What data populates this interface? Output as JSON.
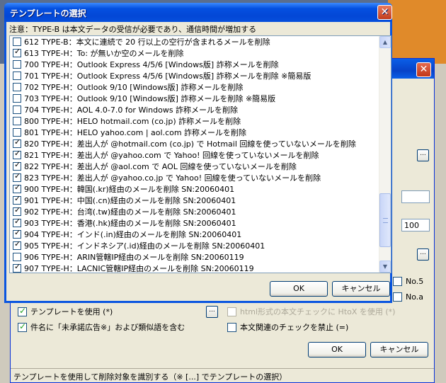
{
  "dialog": {
    "title": "テンプレートの選択",
    "notice": "注意：TYPE-B は本文データの受信が必要であり、通信時間が増加する",
    "ok_label": "OK",
    "cancel_label": "キャンセル",
    "items": [
      {
        "checked": false,
        "label": "612 TYPE-B：本文に連続で 20 行以上の空行が含まれるメールを削除"
      },
      {
        "checked": true,
        "label": "613 TYPE-H：To: が無いか空のメールを削除"
      },
      {
        "checked": false,
        "label": "700 TYPE-H：Outlook Express 4/5/6 [Windows版] 詐称メールを削除"
      },
      {
        "checked": false,
        "label": "701 TYPE-H：Outlook Express 4/5/6 [Windows版] 詐称メールを削除 ※簡易版"
      },
      {
        "checked": false,
        "label": "702 TYPE-H：Outlook 9/10 [Windows版] 詐称メールを削除"
      },
      {
        "checked": false,
        "label": "703 TYPE-H：Outlook 9/10 [Windows版] 詐称メールを削除 ※簡易版"
      },
      {
        "checked": false,
        "label": "704 TYPE-H：AOL 4.0-7.0 for Windows 詐称メールを削除"
      },
      {
        "checked": false,
        "label": "800 TYPE-H：HELO hotmail.com (co.jp) 詐称メールを削除"
      },
      {
        "checked": false,
        "label": "801 TYPE-H：HELO yahoo.com | aol.com 詐称メールを削除"
      },
      {
        "checked": true,
        "label": "820 TYPE-H：差出人が @hotmail.com (co.jp) で Hotmail 回線を使っていないメールを削除"
      },
      {
        "checked": true,
        "label": "821 TYPE-H：差出人が @yahoo.com で Yahoo! 回線を使っていないメールを削除"
      },
      {
        "checked": true,
        "label": "822 TYPE-H：差出人が @aol.com で AOL 回線を使っていないメールを削除"
      },
      {
        "checked": true,
        "label": "823 TYPE-H：差出人が @yahoo.co.jp で Yahoo! 回線を使っていないメールを削除"
      },
      {
        "checked": true,
        "label": "900 TYPE-H：韓国(.kr)経由のメールを削除 SN:20060401"
      },
      {
        "checked": true,
        "label": "901 TYPE-H：中国(.cn)経由のメールを削除 SN:20060401"
      },
      {
        "checked": true,
        "label": "902 TYPE-H：台湾(.tw)経由のメールを削除 SN:20060401"
      },
      {
        "checked": true,
        "label": "903 TYPE-H：香港(.hk)経由のメールを削除 SN:20060401"
      },
      {
        "checked": true,
        "label": "904 TYPE-H：インド(.in)経由のメールを削除 SN:20060401"
      },
      {
        "checked": true,
        "label": "905 TYPE-H：インドネシア(.id)経由のメールを削除 SN:20060401"
      },
      {
        "checked": false,
        "label": "906 TYPE-H：ARIN管轄IP経由のメールを削除 SN:20060119"
      },
      {
        "checked": true,
        "label": "907 TYPE-H：LACNIC管轄IP経由のメールを削除 SN:20060119"
      }
    ]
  },
  "background": {
    "use_template_label": "テンプレートを使用 (*)",
    "use_template_checked": true,
    "subject_label": "件名に「未承諾広告※」および類似語を含む",
    "subject_checked": true,
    "html_check_label": "html形式の本文チェックに HtoX を使用 (*)",
    "html_check_checked": false,
    "body_check_label": "本文関連のチェックを禁止 (=)",
    "body_check_checked": false,
    "number_value": "100",
    "no5_label": "No.5",
    "noa_label": "No.a",
    "ok_label": "OK",
    "cancel_label": "キャンセル",
    "browse_label": "...",
    "status_text": "テンプレートを使用して削除対象を識別する（※ [...] でテンプレートの選択）",
    "close_label": "✕"
  },
  "icons": {
    "close": "close-icon",
    "scroll_up": "scroll-up-icon",
    "scroll_down": "scroll-down-icon"
  }
}
